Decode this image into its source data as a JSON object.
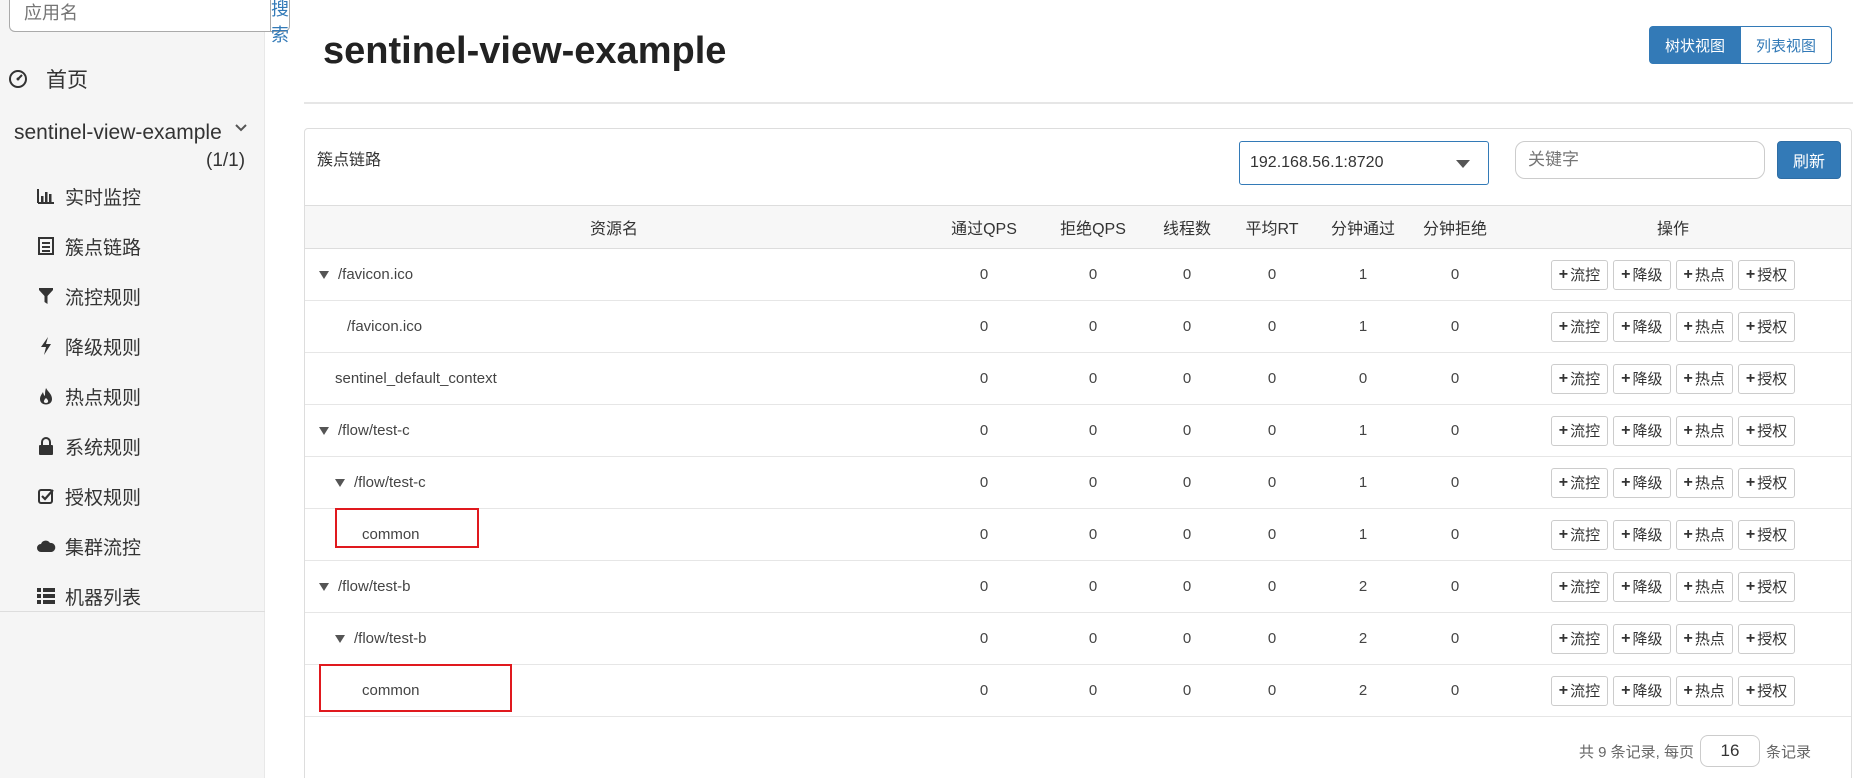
{
  "sidebar": {
    "search_placeholder": "应用名",
    "search_button": "搜索",
    "home": "首页",
    "app_name": "sentinel-view-example",
    "app_count": "(1/1)",
    "menu": [
      {
        "label": "实时监控",
        "icon": "bar-chart-icon"
      },
      {
        "label": "簇点链路",
        "icon": "list-alt-icon"
      },
      {
        "label": "流控规则",
        "icon": "filter-icon"
      },
      {
        "label": "降级规则",
        "icon": "flash-icon"
      },
      {
        "label": "热点规则",
        "icon": "fire-icon"
      },
      {
        "label": "系统规则",
        "icon": "lock-icon"
      },
      {
        "label": "授权规则",
        "icon": "check-icon"
      },
      {
        "label": "集群流控",
        "icon": "cloud-icon"
      },
      {
        "label": "机器列表",
        "icon": "th-list-icon"
      }
    ]
  },
  "header": {
    "title": "sentinel-view-example",
    "tree_view": "树状视图",
    "list_view": "列表视图"
  },
  "panel": {
    "title": "簇点链路",
    "machine": "192.168.56.1:8720",
    "keyword_placeholder": "关键字",
    "refresh": "刷新"
  },
  "table": {
    "columns": [
      "资源名",
      "通过QPS",
      "拒绝QPS",
      "线程数",
      "平均RT",
      "分钟通过",
      "分钟拒绝",
      "操作"
    ],
    "op_labels": [
      "流控",
      "降级",
      "热点",
      "授权"
    ],
    "rows": [
      {
        "name": "/favicon.ico",
        "level": 1,
        "expand": true,
        "values": [
          "0",
          "0",
          "0",
          "0",
          "1",
          "0"
        ]
      },
      {
        "name": "/favicon.ico",
        "level": 3,
        "expand": false,
        "values": [
          "0",
          "0",
          "0",
          "0",
          "1",
          "0"
        ]
      },
      {
        "name": "sentinel_default_context",
        "level": 2,
        "expand": false,
        "values": [
          "0",
          "0",
          "0",
          "0",
          "0",
          "0"
        ]
      },
      {
        "name": "/flow/test-c",
        "level": 1,
        "expand": true,
        "values": [
          "0",
          "0",
          "0",
          "0",
          "1",
          "0"
        ]
      },
      {
        "name": "/flow/test-c",
        "level": 2,
        "expand": true,
        "values": [
          "0",
          "0",
          "0",
          "0",
          "1",
          "0"
        ]
      },
      {
        "name": "common",
        "level": 4,
        "expand": false,
        "values": [
          "0",
          "0",
          "0",
          "0",
          "1",
          "0"
        ]
      },
      {
        "name": "/flow/test-b",
        "level": 1,
        "expand": true,
        "values": [
          "0",
          "0",
          "0",
          "0",
          "2",
          "0"
        ]
      },
      {
        "name": "/flow/test-b",
        "level": 2,
        "expand": true,
        "values": [
          "0",
          "0",
          "0",
          "0",
          "2",
          "0"
        ]
      },
      {
        "name": "common",
        "level": 4,
        "expand": false,
        "values": [
          "0",
          "0",
          "0",
          "0",
          "2",
          "0"
        ]
      }
    ]
  },
  "pager": {
    "prefix": "共 9 条记录, 每页",
    "page_size": "16",
    "suffix": "条记录"
  },
  "colors": {
    "primary": "#337ab7",
    "highlight": "#e0191e"
  }
}
